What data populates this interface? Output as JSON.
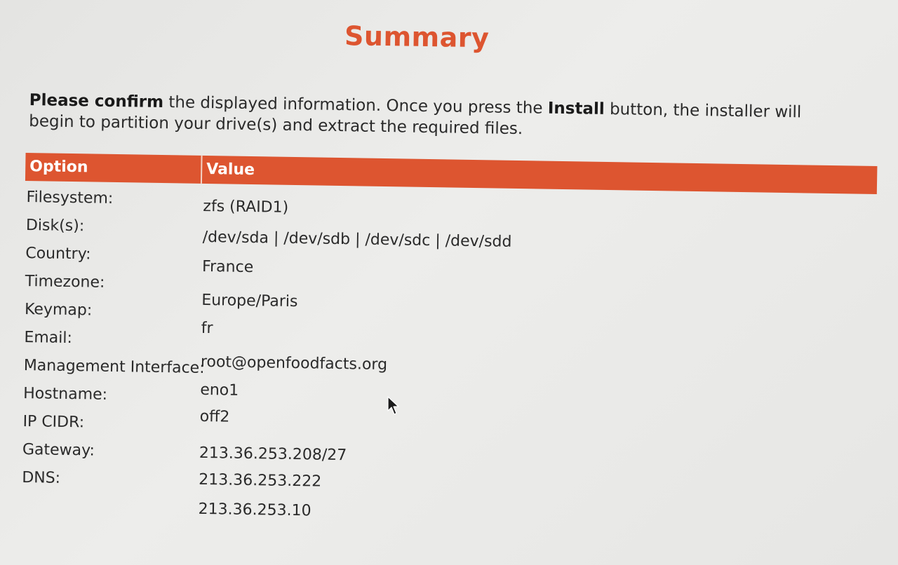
{
  "page": {
    "title": "Summary",
    "intro": {
      "bold1": "Please confirm",
      "text1": " the displayed information. Once you press the ",
      "bold2": "Install",
      "text2": " button, the installer will begin to partition your drive(s) and extract the required files."
    }
  },
  "table": {
    "headers": {
      "option": "Option",
      "value": "Value"
    },
    "labels": [
      "Filesystem:",
      "Disk(s):",
      "Country:",
      "Timezone:",
      "Keymap:",
      "Email:",
      "Management Interface:",
      "Hostname:",
      "IP CIDR:",
      "Gateway:",
      "DNS:"
    ],
    "values": [
      "zfs (RAID1)",
      "/dev/sda | /dev/sdb | /dev/sdc | /dev/sdd",
      "France",
      "Europe/Paris",
      "fr",
      "root@openfoodfacts.org",
      "eno1",
      "off2",
      "213.36.253.208/27",
      "213.36.253.222",
      "213.36.253.10"
    ]
  },
  "colors": {
    "accent": "#dd5530",
    "text": "#2a2a2a",
    "background": "#e9e9e7"
  },
  "icons": {
    "cursor": "mouse-pointer-icon"
  }
}
